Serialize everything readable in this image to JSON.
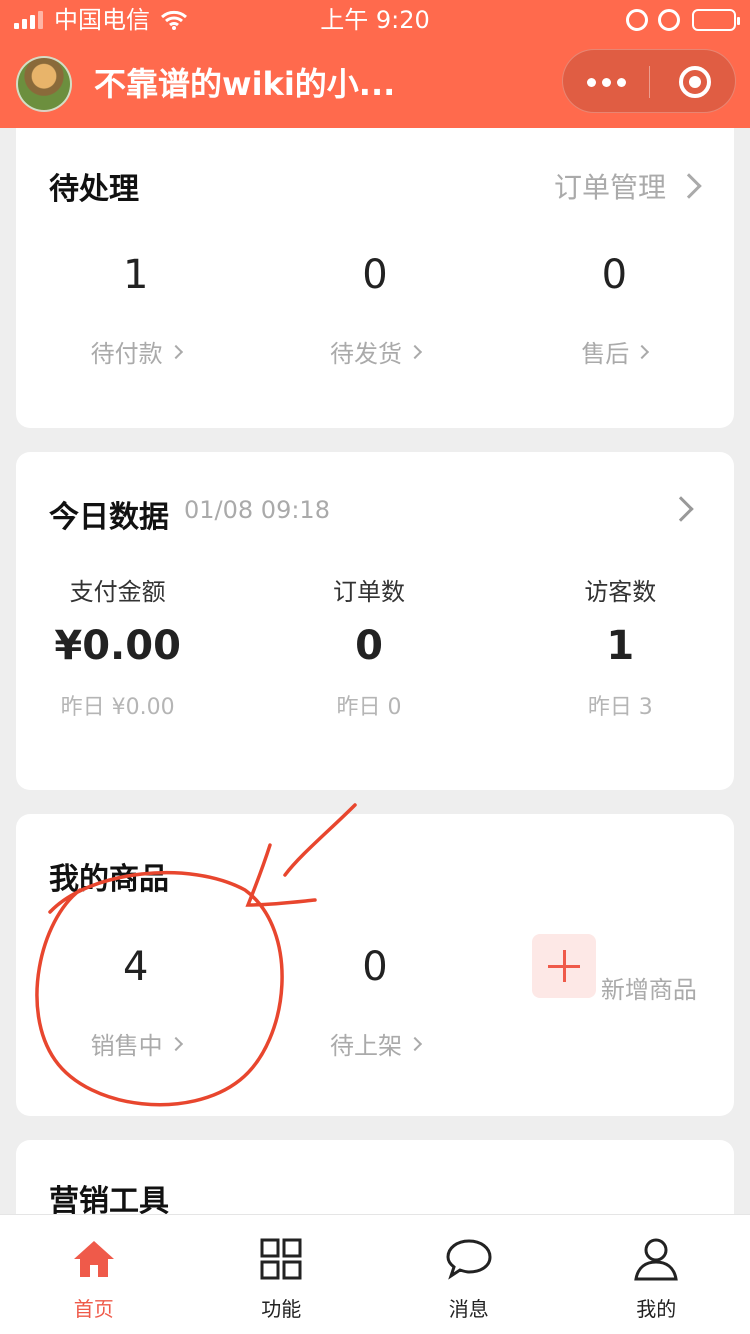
{
  "status_bar": {
    "carrier": "中国电信",
    "time": "上午 9:20"
  },
  "nav": {
    "title": "不靠谱的wiki的小..."
  },
  "pending": {
    "title": "待处理",
    "link": "订单管理",
    "items": [
      {
        "value": "1",
        "label": "待付款"
      },
      {
        "value": "0",
        "label": "待发货"
      },
      {
        "value": "0",
        "label": "售后"
      }
    ]
  },
  "today": {
    "title": "今日数据",
    "timestamp": "01/08 09:18",
    "metrics": [
      {
        "label": "支付金额",
        "value": "¥0.00",
        "yesterday": "昨日 ¥0.00"
      },
      {
        "label": "订单数",
        "value": "0",
        "yesterday": "昨日 0"
      },
      {
        "label": "访客数",
        "value": "1",
        "yesterday": "昨日 3"
      }
    ]
  },
  "goods": {
    "title": "我的商品",
    "items": [
      {
        "value": "4",
        "label": "销售中"
      },
      {
        "value": "0",
        "label": "待上架"
      }
    ],
    "add_label": "新增商品"
  },
  "marketing": {
    "title": "营销工具"
  },
  "tabbar": {
    "items": [
      {
        "label": "首页",
        "icon": "home-icon",
        "active": true
      },
      {
        "label": "功能",
        "icon": "grid-icon",
        "active": false
      },
      {
        "label": "消息",
        "icon": "message-icon",
        "active": false
      },
      {
        "label": "我的",
        "icon": "user-icon",
        "active": false
      }
    ]
  },
  "colors": {
    "brand": "#ff6a4d",
    "accent": "#ef5a4a",
    "annotation": "#e8462e"
  }
}
